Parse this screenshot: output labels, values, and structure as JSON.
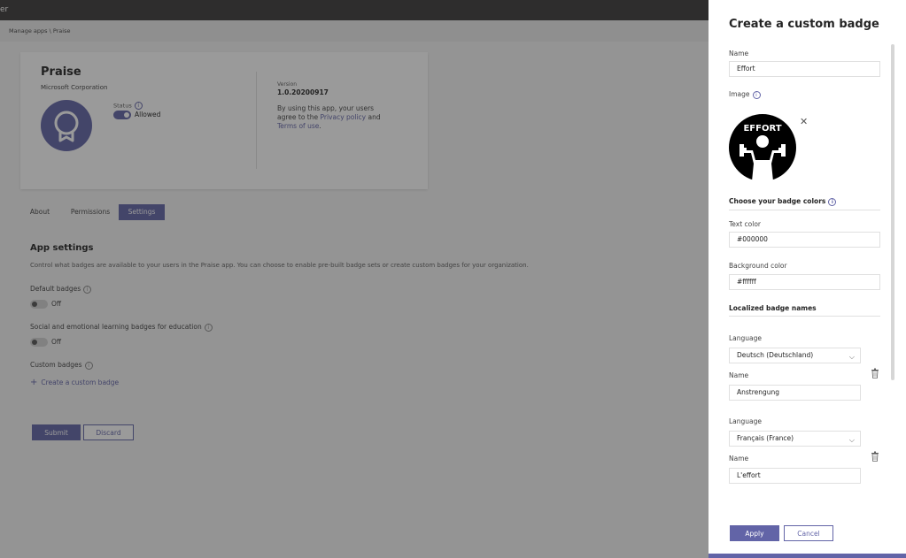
{
  "topbar": {
    "title": "er"
  },
  "breadcrumb": "Manage apps \\ Praise",
  "app": {
    "name": "Praise",
    "publisher": "Microsoft Corporation",
    "status_label": "Status",
    "status_value": "Allowed",
    "version_label": "Version",
    "version_value": "1.0.20200917",
    "terms_prefix": "By using this app, your users agree to the ",
    "privacy_link": "Privacy policy",
    "terms_and": " and ",
    "terms_link": "Terms of use",
    "terms_suffix": "."
  },
  "tabs": [
    {
      "label": "About"
    },
    {
      "label": "Permissions"
    },
    {
      "label": "Settings"
    }
  ],
  "settings": {
    "title": "App settings",
    "description": "Control what badges are available to your users in the Praise app. You can choose to enable pre-built badge sets or create custom badges for your organization.",
    "default_badges_label": "Default badges",
    "default_badges_value": "Off",
    "sel_badges_label": "Social and emotional learning badges for education",
    "sel_badges_value": "Off",
    "custom_badges_label": "Custom badges",
    "create_link": "Create a custom badge",
    "submit_label": "Submit",
    "discard_label": "Discard"
  },
  "panel": {
    "title": "Create a custom badge",
    "name_label": "Name",
    "name_value": "Effort",
    "image_label": "Image",
    "badge_text": "EFFORT",
    "colors_section": "Choose your badge colors",
    "text_color_label": "Text color",
    "text_color_value": "#000000",
    "bg_color_label": "Background color",
    "bg_color_value": "#ffffff",
    "localized_section": "Localized badge names",
    "localized": [
      {
        "language_label": "Language",
        "language_value": "Deutsch (Deutschland)",
        "name_label": "Name",
        "name_value": "Anstrengung"
      },
      {
        "language_label": "Language",
        "language_value": "Français (France)",
        "name_label": "Name",
        "name_value": "L'effort"
      }
    ],
    "apply_label": "Apply",
    "cancel_label": "Cancel"
  },
  "colors": {
    "accent": "#6264a7",
    "topbar": "#3b3a39"
  }
}
